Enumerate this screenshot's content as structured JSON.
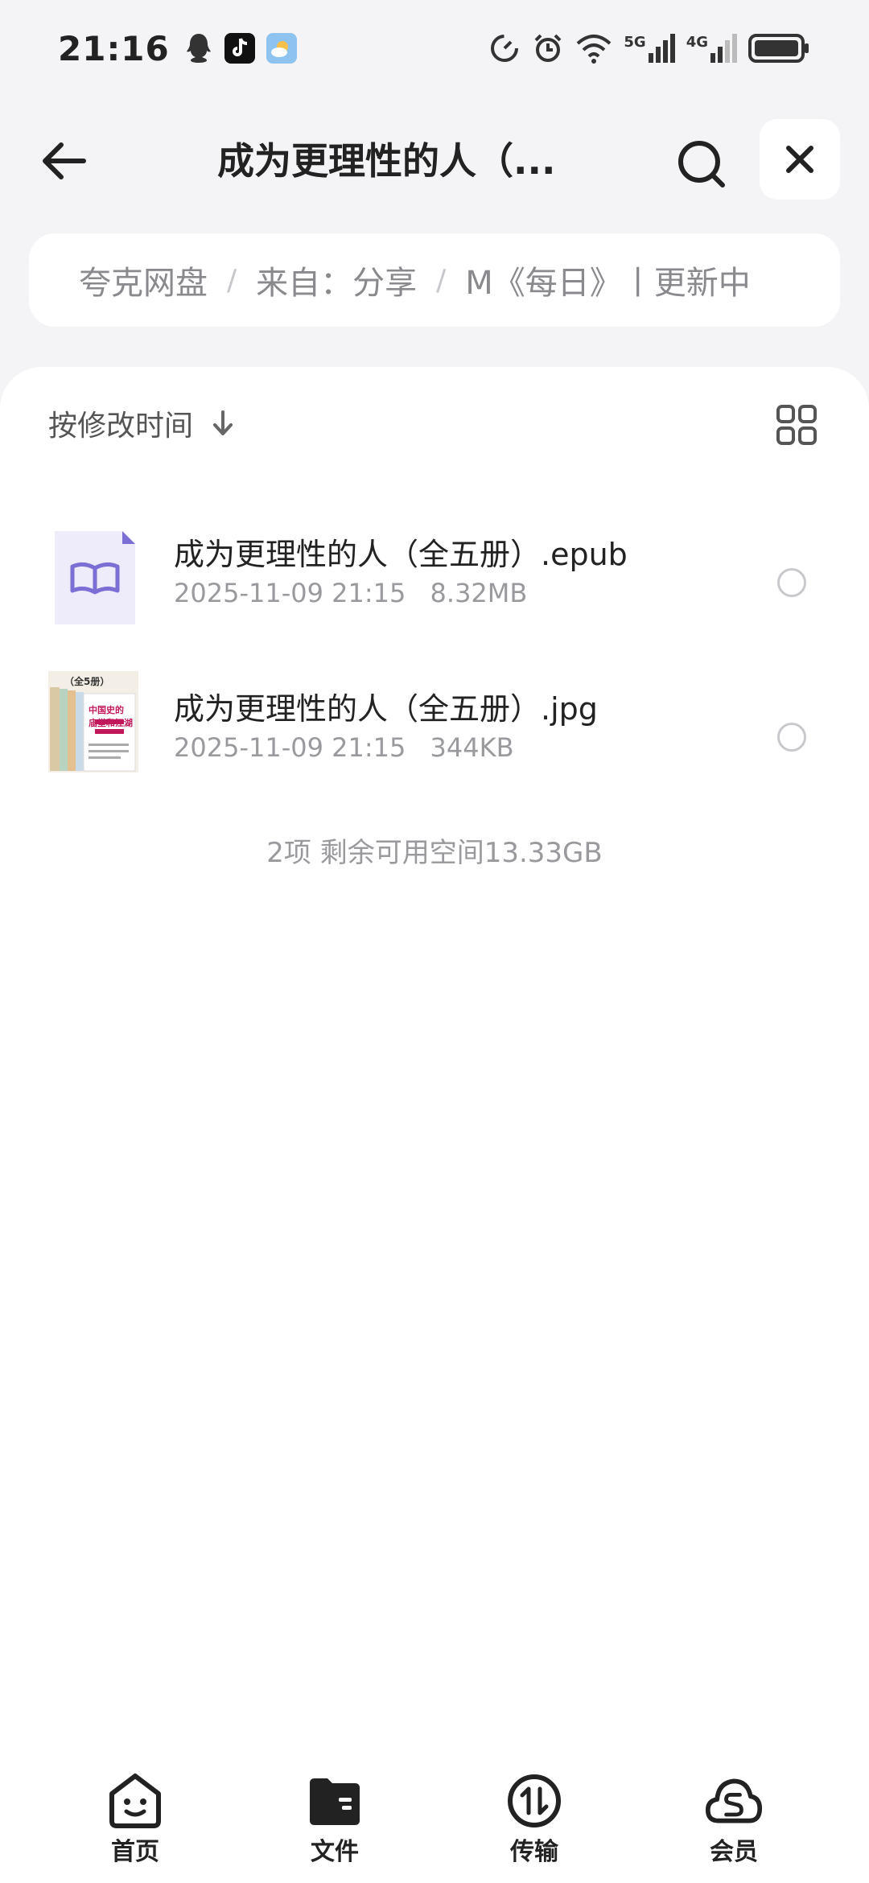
{
  "status_bar": {
    "time": "21:16",
    "network_5g": "5G",
    "network_4g": "4G"
  },
  "header": {
    "title": "成为更理性的人（..."
  },
  "breadcrumb": {
    "items": [
      "夸克网盘",
      "来自：分享",
      "M《每日》丨更新中"
    ]
  },
  "sort": {
    "label": "按修改时间"
  },
  "files": [
    {
      "name": "成为更理性的人（全五册）.epub",
      "date": "2025-11-09 21:15",
      "size": "8.32MB",
      "type": "epub"
    },
    {
      "name": "成为更理性的人（全五册）.jpg",
      "date": "2025-11-09 21:15",
      "size": "344KB",
      "type": "image",
      "thumb_text": {
        "badge": "（全5册）",
        "headline_1": "中国史的",
        "headline_2": "庙堂和江湖"
      }
    }
  ],
  "summary": "2项 剩余可用空间13.33GB",
  "nav": {
    "home": "首页",
    "files": "文件",
    "transfer": "传输",
    "member": "会员"
  },
  "colors": {
    "background": "#f4f4f6",
    "card": "#ffffff",
    "epub_accent": "#7b6fd6",
    "text_primary": "#222222",
    "text_secondary": "#9a9a9e"
  }
}
